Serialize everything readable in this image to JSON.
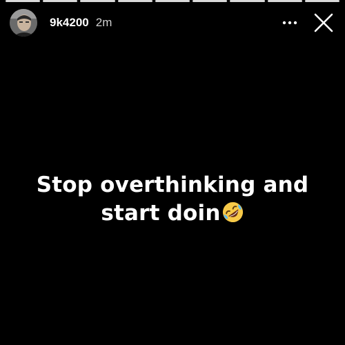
{
  "progress": {
    "segments": 9,
    "current_index": 8
  },
  "header": {
    "username": "9k4200",
    "time": "2m",
    "avatar_icon": "profile-photo",
    "more_icon": "more-horizontal-icon",
    "close_icon": "close-icon"
  },
  "caption": {
    "line1": "Stop overthinking and",
    "line2": "start doin",
    "emoji": "rolling-on-floor-laughing-emoji"
  },
  "colors": {
    "background": "#000000",
    "text": "#ffffff",
    "progress": "#d9d9d9"
  }
}
